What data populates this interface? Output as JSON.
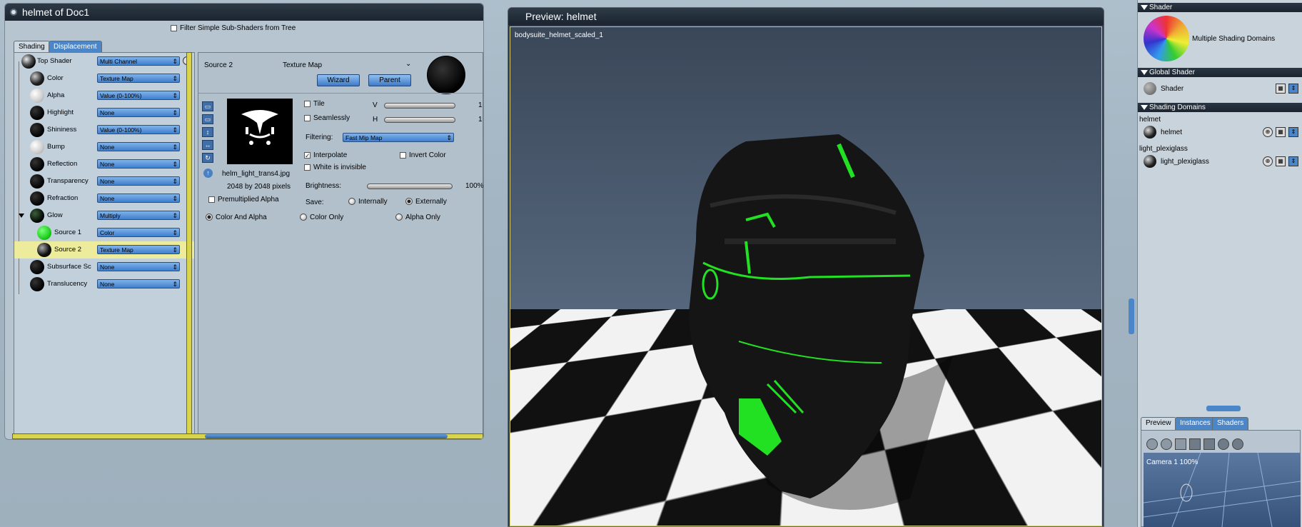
{
  "shader_window": {
    "title": "helmet of Doc1",
    "filter_label": "Filter Simple Sub-Shaders from Tree",
    "tabs": [
      "Shading",
      "Displacement"
    ],
    "tree": [
      {
        "label": "Top Shader",
        "type": "Multi Channel"
      },
      {
        "label": "Color",
        "type": "Texture Map"
      },
      {
        "label": "Alpha",
        "type": "Value (0-100%)"
      },
      {
        "label": "Highlight",
        "type": "None"
      },
      {
        "label": "Shininess",
        "type": "Value (0-100%)"
      },
      {
        "label": "Bump",
        "type": "None"
      },
      {
        "label": "Reflection",
        "type": "None"
      },
      {
        "label": "Transparency",
        "type": "None"
      },
      {
        "label": "Refraction",
        "type": "None"
      },
      {
        "label": "Glow",
        "type": "Multiply"
      },
      {
        "label": "Source 1",
        "type": "Color"
      },
      {
        "label": "Source 2",
        "type": "Texture Map"
      },
      {
        "label": "Subsurface Sc",
        "type": "None"
      },
      {
        "label": "Translucency",
        "type": "None"
      }
    ],
    "detail": {
      "source": "Source 2",
      "kind": "Texture Map",
      "wizard": "Wizard",
      "parent": "Parent",
      "filename": "helm_light_trans4.jpg",
      "size": "2048 by 2048 pixels",
      "tile": "Tile",
      "seamlessly": "Seamlessly",
      "v": "V",
      "h": "H",
      "v_val": "1",
      "h_val": "1",
      "filtering_label": "Filtering:",
      "filtering_value": "Fast Mip Map",
      "interpolate": "Interpolate",
      "invert_color": "Invert Color",
      "white_invisible": "White is invisible",
      "brightness_label": "Brightness:",
      "brightness_value": "100%",
      "save_label": "Save:",
      "internally": "Internally",
      "externally": "Externally",
      "premultiplied": "Premultiplied Alpha",
      "color_and_alpha": "Color And Alpha",
      "color_only": "Color Only",
      "alpha_only": "Alpha Only"
    }
  },
  "preview": {
    "title": "Preview: helmet",
    "object_label": "bodysuite_helmet_scaled_1"
  },
  "right_panel": {
    "shader_head": "Shader",
    "shader_name": "Multiple Shading Domains",
    "global_head": "Global Shader",
    "global_name": "Shader",
    "domains_head": "Shading Domains",
    "domain1_group": "helmet",
    "domain1_name": "helmet",
    "domain2_group": "light_plexiglass",
    "domain2_name": "light_plexiglass",
    "tabs": [
      "Preview",
      "Instances",
      "Shaders"
    ],
    "camera": "Camera 1 100%"
  }
}
